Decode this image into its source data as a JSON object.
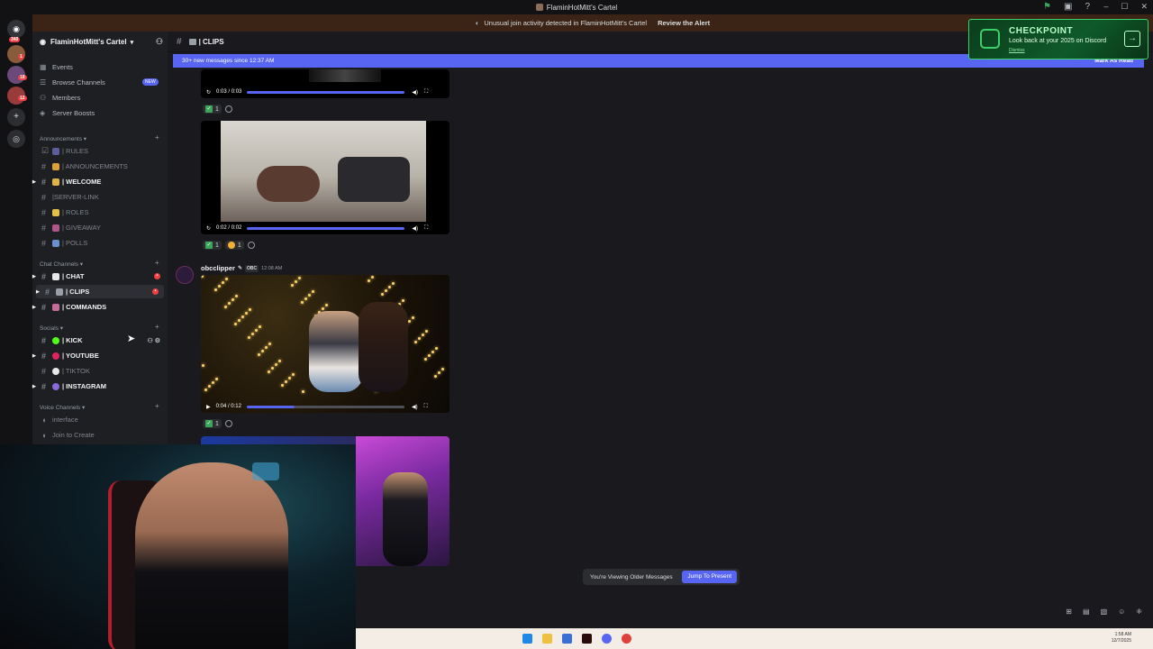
{
  "window": {
    "title": "FlaminHotMitt's Cartel"
  },
  "alert": {
    "text": "Unusual join activity detected in FlaminHotMitt's Cartel",
    "link": "Review the Alert"
  },
  "rail": {
    "home_badge": "340",
    "badge_1": "1",
    "badge_2": "18",
    "badge_3": "12"
  },
  "sidebar": {
    "server_name": "FlaminHotMitt's Cartel",
    "nav": [
      {
        "label": "Events",
        "icon": "calendar-icon"
      },
      {
        "label": "Browse Channels",
        "icon": "browse-icon",
        "badge": "NEW"
      },
      {
        "label": "Members",
        "icon": "members-icon"
      },
      {
        "label": "Server Boosts",
        "icon": "boost-icon"
      }
    ],
    "categories": {
      "announcements": "Announcements",
      "chat": "Chat Channels",
      "socials": "Socials",
      "voice": "Voice Channels"
    },
    "announce_channels": [
      "| RULES",
      "| ANNOUNCEMENTS",
      "| WELCOME",
      "|SERVER-LINK",
      "| ROLES",
      "| GIVEAWAY",
      "| POLLS"
    ],
    "chat_channels": [
      "| CHAT",
      "| CLIPS",
      "| COMMANDS"
    ],
    "social_channels": [
      "| KICK",
      "| YOUTUBE",
      "| TIKTOK",
      "| INSTAGRAM"
    ],
    "voice_channels": [
      "interface",
      "Join to Create"
    ]
  },
  "header": {
    "channel": "| CLIPS"
  },
  "new_messages": {
    "text": "30+ new messages since 12:37 AM",
    "mark": "Mark As Read"
  },
  "messages": {
    "video1_time": "0:03 / 0:03",
    "video2_time": "0:02 / 0:02",
    "video3_time": "0:04 / 0:12",
    "r1_count": "1",
    "r2_check": "1",
    "r2_other": "1",
    "r3_count": "1",
    "author": "obcclipper",
    "author_tag": "OBC",
    "timestamp": "12:08 AM"
  },
  "older": {
    "text": "You're Viewing Older Messages",
    "jump": "Jump To Present"
  },
  "promo": {
    "title": "CHECKPOINT",
    "subtitle": "Look back at your 2025 on Discord",
    "dismiss": "Dismiss"
  },
  "taskbar": {
    "time": "1:58 AM",
    "date": "12/7/2025"
  },
  "colors": {
    "blurple": "#5865f2",
    "alert_bg": "#3b2416",
    "mention": "#f23f43",
    "promo": "#0e5a29"
  }
}
